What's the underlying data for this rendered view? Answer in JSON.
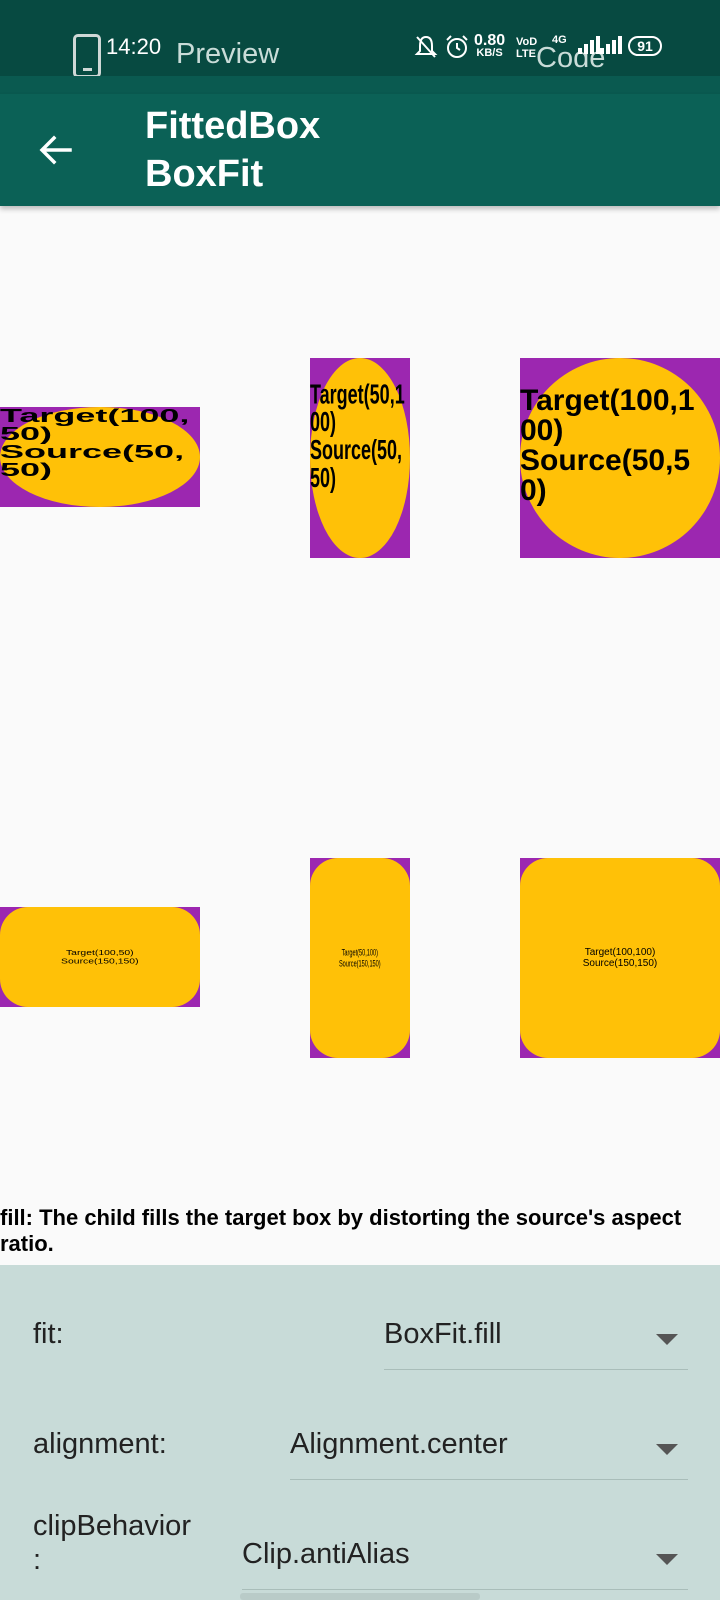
{
  "status_bar": {
    "time": "14:20",
    "preview_label": "Preview",
    "speed_value": "0.80",
    "speed_unit": "KB/S",
    "volte": "VoD\nLTE",
    "network": "4G",
    "code_label": "Code",
    "battery": "91"
  },
  "app_bar": {
    "title": "FittedBox BoxFit"
  },
  "demos": {
    "oval_texts": [
      "Target(100,50)\nSource(50,50)",
      "Target(50,100)\nSource(50,50)",
      "Target(100,100)\nSource(50,50)"
    ],
    "rounded_texts": [
      "Target(100,50)\nSource(150,150)",
      "Target(50,100)\nSource(150,150)",
      "Target(100,100)\nSource(150,150)"
    ]
  },
  "description": "fill: The child fills the target box by distorting the source's aspect ratio.",
  "controls": {
    "fit": {
      "label": "fit:",
      "value": "BoxFit.fill"
    },
    "alignment": {
      "label": "alignment:",
      "value": "Alignment.center"
    },
    "clip": {
      "label": "clipBehavior\n:",
      "value": "Clip.antiAlias"
    }
  },
  "colors": {
    "status_bar": "#074a41",
    "app_bar": "#0b6156",
    "target_box": "#9c27b0",
    "source_box": "#ffc107",
    "controls_bg": "#c8dbd8"
  },
  "icons": [
    "phone-icon",
    "mute-icon",
    "alarm-icon",
    "signal-icon",
    "battery-icon",
    "back-arrow-icon",
    "dropdown-caret-icon"
  ]
}
